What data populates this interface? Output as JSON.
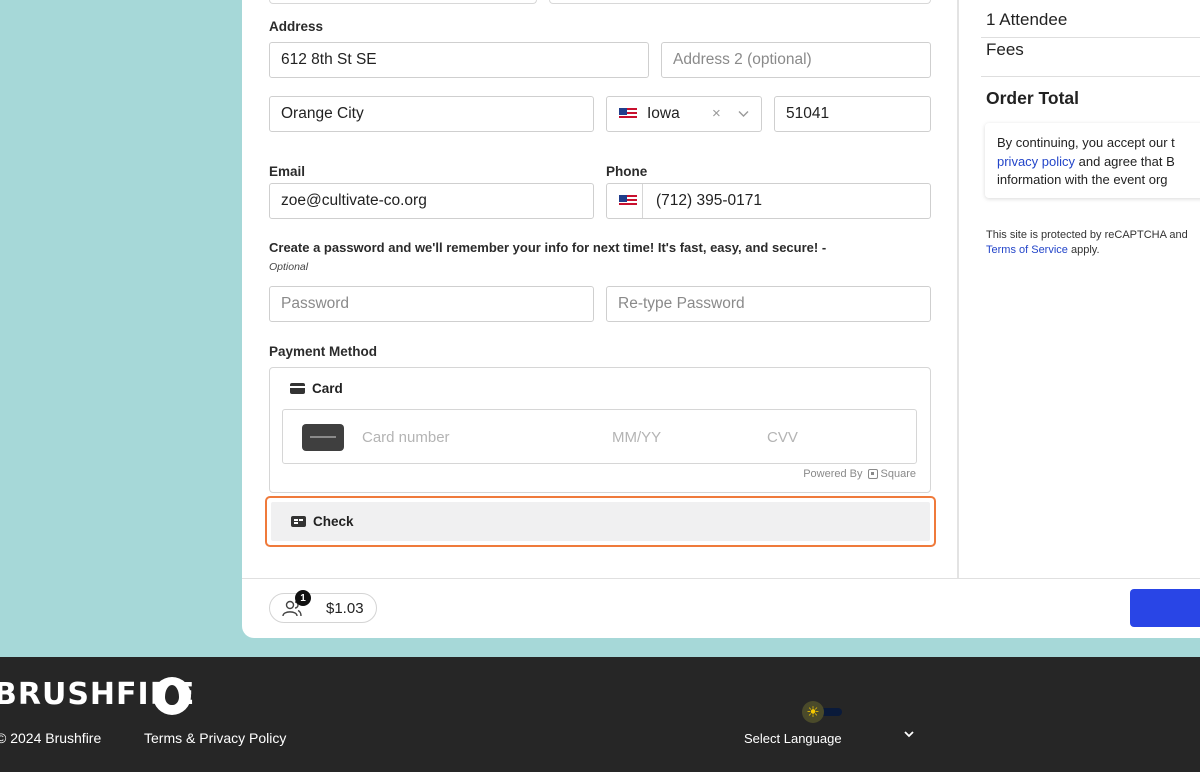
{
  "form": {
    "address_label": "Address",
    "address1_value": "612 8th St SE",
    "address2_placeholder": "Address 2 (optional)",
    "city_value": "Orange City",
    "state_value": "Iowa",
    "zip_value": "51041",
    "email_label": "Email",
    "email_value": "zoe@cultivate-co.org",
    "phone_label": "Phone",
    "phone_value": "(712) 395-0171",
    "password_prompt": "Create a password and we'll remember your info for next time! It's fast, easy, and secure! -",
    "password_optional": "Optional",
    "password_placeholder": "Password",
    "retype_placeholder": "Re-type Password"
  },
  "payment": {
    "label": "Payment Method",
    "card_option": "Card",
    "card_number_placeholder": "Card number",
    "expiry_placeholder": "MM/YY",
    "cvv_placeholder": "CVV",
    "powered_by": "Powered By",
    "powered_brand": "Square",
    "check_option": "Check"
  },
  "cart": {
    "attendee_count": "1",
    "amount": "$1.03"
  },
  "summary": {
    "attendees": "1 Attendee",
    "fees": "Fees",
    "order_total": "Order Total",
    "consent_line1": "By continuing, you accept our t",
    "consent_link2": "privacy policy",
    "consent_line2": " and agree that B",
    "consent_line3": "information with the event org",
    "recaptcha_line1": "This site is protected by reCAPTCHA and",
    "recaptcha_link": "Terms of Service",
    "recaptcha_line2": " apply."
  },
  "footer": {
    "logo_text": "BRUSHFIRE",
    "copyright": "© 2024 Brushfire",
    "terms": "Terms & Privacy Policy",
    "select_language": "Select Language",
    "theme_icon": "sun-icon"
  },
  "colors": {
    "accent_blue": "#2945e6",
    "focus_orange": "#ef7a3b",
    "page_bg": "#a6d8d8",
    "footer_bg": "#262626"
  }
}
